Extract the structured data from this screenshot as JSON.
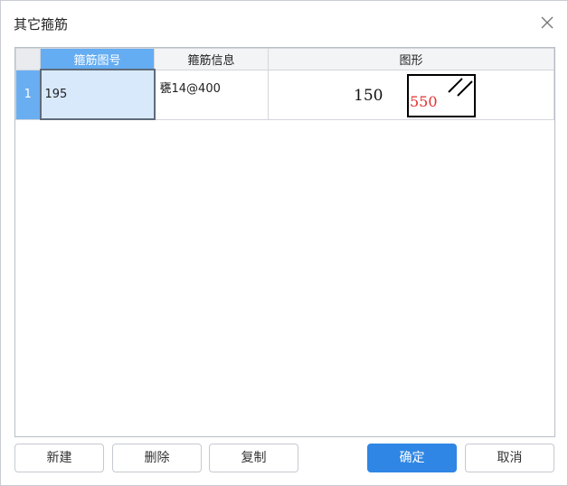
{
  "dialog": {
    "title": "其它箍筋"
  },
  "table": {
    "columns": [
      "箍筋图号",
      "箍筋信息",
      "图形"
    ],
    "rows": [
      {
        "index": "1",
        "number": "195",
        "info": "甕14@400",
        "shape_dim_a": "150",
        "shape_dim_b": "550"
      }
    ]
  },
  "buttons": {
    "new": "新建",
    "delete": "删除",
    "copy": "复制",
    "ok": "确定",
    "cancel": "取消"
  },
  "colors": {
    "accent": "#2f86e4",
    "header_selected": "#65adf2",
    "dimension_red": "#e23030"
  },
  "icons": {
    "close": "close-icon"
  }
}
